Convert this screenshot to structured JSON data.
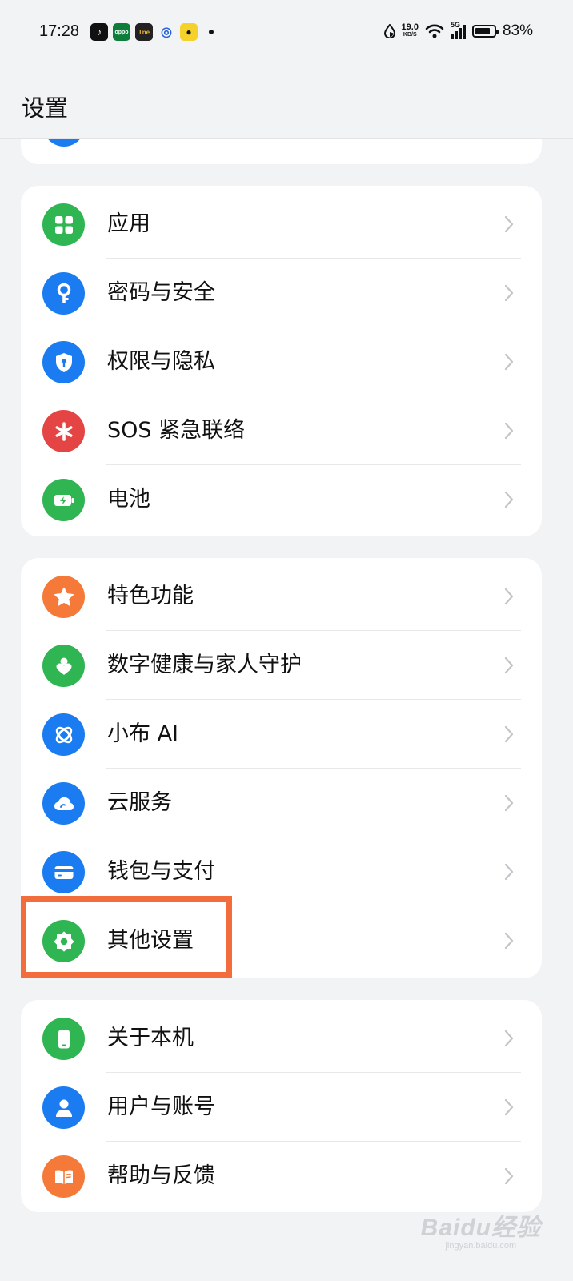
{
  "status_bar": {
    "time": "17:28",
    "net_speed_value": "19.0",
    "net_speed_unit": "KB/S",
    "network": "5G",
    "battery_percent": "83%",
    "battery_level": 0.83,
    "notification_icons": [
      "tiktok-icon",
      "oppo-app-icon",
      "tne-app-icon",
      "browser-icon",
      "bear-app-icon"
    ]
  },
  "header": {
    "title": "设置"
  },
  "groups": [
    {
      "items": [
        {
          "label": "应用",
          "icon": "apps-grid-icon",
          "color": "#2fb552"
        },
        {
          "label": "密码与安全",
          "icon": "key-icon",
          "color": "#1a7cf0"
        },
        {
          "label": "权限与隐私",
          "icon": "shield-icon",
          "color": "#1a7cf0"
        },
        {
          "label": "SOS 紧急联络",
          "icon": "sos-asterisk-icon",
          "color": "#e44544"
        },
        {
          "label": "电池",
          "icon": "battery-icon",
          "color": "#2fb552"
        }
      ]
    },
    {
      "items": [
        {
          "label": "特色功能",
          "icon": "star-icon",
          "color": "#f57a3a"
        },
        {
          "label": "数字健康与家人守护",
          "icon": "wellbeing-icon",
          "color": "#2fb552"
        },
        {
          "label": "小布 AI",
          "icon": "ai-assistant-icon",
          "color": "#1a7cf0"
        },
        {
          "label": "云服务",
          "icon": "cloud-icon",
          "color": "#1a7cf0"
        },
        {
          "label": "钱包与支付",
          "icon": "wallet-card-icon",
          "color": "#1a7cf0"
        },
        {
          "label": "其他设置",
          "icon": "gear-icon",
          "color": "#2fb552"
        }
      ]
    },
    {
      "items": [
        {
          "label": "关于本机",
          "icon": "phone-icon",
          "color": "#2fb552"
        },
        {
          "label": "用户与账号",
          "icon": "user-icon",
          "color": "#1a7cf0"
        },
        {
          "label": "帮助与反馈",
          "icon": "help-book-icon",
          "color": "#f57a3a"
        }
      ]
    }
  ],
  "highlight": {
    "target": "其他设置",
    "color": "#f26d3b"
  },
  "watermark": {
    "main": "Baidu经验",
    "sub": "jingyan.baidu.com"
  }
}
